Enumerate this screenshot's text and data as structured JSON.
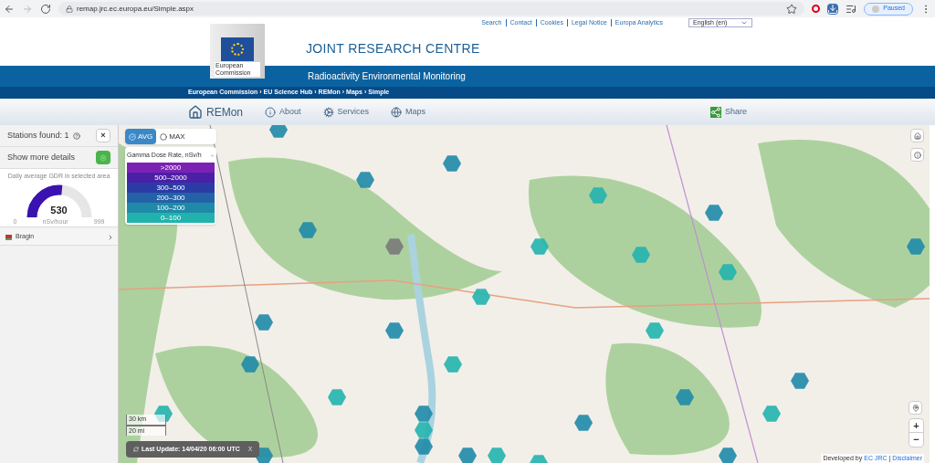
{
  "browser": {
    "url": "remap.jrc.ec.europa.eu/Simple.aspx",
    "profile": "Paused"
  },
  "top_links": [
    "Search",
    "Contact",
    "Cookies",
    "Legal Notice",
    "Europa Analytics"
  ],
  "language": "English (en)",
  "logo": {
    "line1": "European",
    "line2": "Commission"
  },
  "header": {
    "title": "JOINT RESEARCH CENTRE",
    "subtitle": "Radioactivity Environmental Monitoring"
  },
  "breadcrumb": {
    "separator": "›",
    "items": [
      "European Commission",
      "EU Science Hub",
      "REMon",
      "Maps",
      "Simple"
    ]
  },
  "nav": [
    {
      "label": "REMon",
      "kind": "home"
    },
    {
      "label": "About",
      "kind": "info"
    },
    {
      "label": "Services",
      "kind": "gears"
    },
    {
      "label": "Maps",
      "kind": "globe"
    }
  ],
  "share": "Share",
  "sidebar": {
    "stations_found": "Stations found: 1",
    "close": "×",
    "details": "Show more details",
    "gauge": {
      "title": "Daily average GDR in selected area",
      "value": "530",
      "min": "0",
      "unit": "nSv/hour",
      "max": "999",
      "level": 0.53
    },
    "stations": [
      {
        "name": "Bragin",
        "expanded": false
      }
    ]
  },
  "map": {
    "modes": [
      {
        "label": "AVG",
        "selected": true
      },
      {
        "label": "MAX",
        "selected": false
      }
    ],
    "legend": {
      "title": "Gamma Dose Rate, nSv/h",
      "expanded": true,
      "items": [
        {
          "label": ">2000",
          "color": "#7b22b5"
        },
        {
          "label": "500–2000",
          "color": "#4b1fa6"
        },
        {
          "label": "300–500",
          "color": "#2b3ba6"
        },
        {
          "label": "200–300",
          "color": "#2462a8"
        },
        {
          "label": "100–200",
          "color": "#1f8aa8"
        },
        {
          "label": "0–100",
          "color": "#22b2ae"
        }
      ]
    },
    "scale": [
      "30 km",
      "20 mi"
    ],
    "last_update": "Last Update: 14/04/20 06:00 UTC",
    "dismiss": "X",
    "zoom_in": "+",
    "zoom_out": "−",
    "attribution": {
      "prefix": "Developed by",
      "link1": "EC JRC",
      "sep": "|",
      "link2": "Disclaimer"
    }
  }
}
